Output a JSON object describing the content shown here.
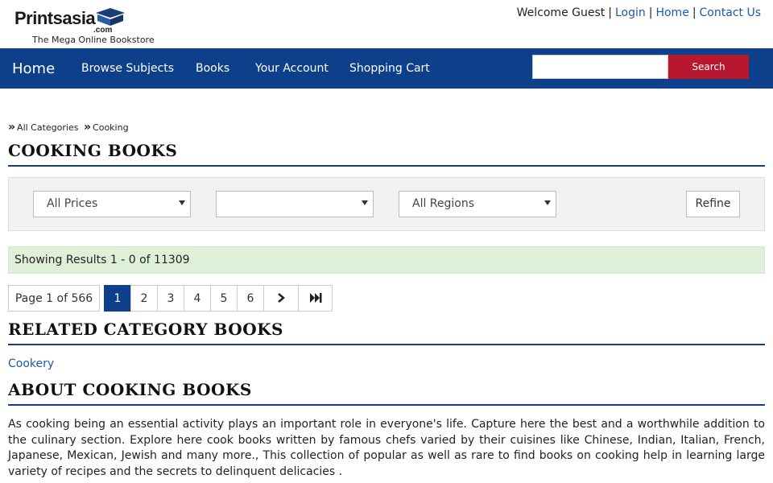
{
  "header": {
    "logo_text": "Printsasia",
    "logo_com": ".com",
    "tagline": "The Mega Online Bookstore",
    "welcome": "Welcome Guest",
    "login": "Login",
    "home": "Home",
    "contact": "Contact Us"
  },
  "nav": {
    "home": "Home",
    "items": [
      "Browse Subjects",
      "Books",
      "Your Account",
      "Shopping Cart"
    ],
    "search_button": "Search",
    "search_placeholder": ""
  },
  "breadcrumb": [
    "All Categories",
    "Cooking"
  ],
  "page_title": "COOKING BOOKS",
  "filters": {
    "price": "All Prices",
    "second": "",
    "region": "All Regions",
    "refine": "Refine"
  },
  "results_text": "Showing Results 1 - 0 of 11309",
  "pagination": {
    "page_info": "Page 1 of 566",
    "pages": [
      "1",
      "2",
      "3",
      "4",
      "5",
      "6"
    ],
    "current": "1"
  },
  "related": {
    "title": "RELATED CATEGORY BOOKS",
    "links": [
      "Cookery"
    ]
  },
  "about": {
    "title": "ABOUT COOKING BOOKS",
    "text": "As cooking being an essential activity plays an important role in everyone's life. Capture here the best and a worthwhile addition to the culinary section. Explore here cook books written by famous chefs varied by their cuisines like Chinese, Indian, Italian, French, Japanese, Mexican, Jewish and many more., This collection of popular as well as rare to find books on cooking help in learning large variety of recipes and the secrets to delinquent delicacies ."
  },
  "colors": {
    "nav_bg": "#0d3f8a",
    "search_btn": "#b8182f",
    "link": "#1b5aa6",
    "results_bg": "#dff0d8"
  }
}
